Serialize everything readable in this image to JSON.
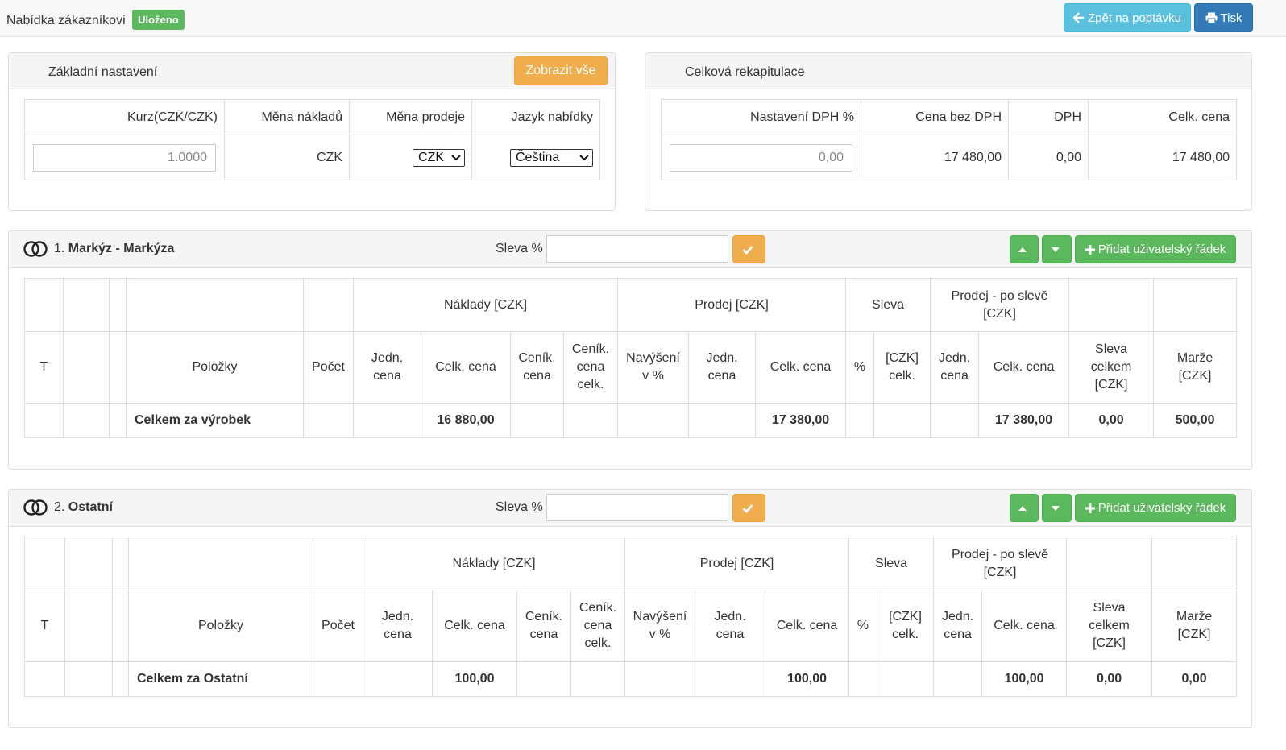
{
  "header": {
    "title": "Nabídka zákazníkovi",
    "status_badge": "Uloženo",
    "back_button": "Zpět na poptávku",
    "print_button": "Tisk"
  },
  "basic_settings": {
    "title": "Základní nastavení",
    "show_all_button": "Zobrazit vše",
    "columns": [
      "Kurz(CZK/CZK)",
      "Měna nákladů",
      "Měna prodeje",
      "Jazyk nabídky"
    ],
    "rate_value": "1.0000",
    "cost_currency": "CZK",
    "sale_currency": "CZK",
    "language": "Čeština"
  },
  "recap": {
    "title": "Celková rekapitulace",
    "columns": [
      "Nastavení DPH %",
      "Cena bez DPH",
      "DPH",
      "Celk. cena"
    ],
    "vat_value": "0,00",
    "price_without_vat": "17 480,00",
    "vat": "0,00",
    "total": "17 480,00"
  },
  "common": {
    "discount_label": "Sleva %",
    "add_row_button": "Přidat uživatelský řádek",
    "group_headers": {
      "costs": "Náklady [CZK]",
      "sales": "Prodej [CZK]",
      "discount": "Sleva",
      "sales_after": "Prodej - po slevě [CZK]"
    },
    "columns": {
      "t": "T",
      "items": "Položky",
      "count": "Počet",
      "unit_price": "Jedn. cena",
      "total_price": "Celk. cena",
      "list_price": "Ceník. cena",
      "list_price_total": "Ceník. cena celk.",
      "markup": "Navýšení v %",
      "percent": "%",
      "czk_total": "[CZK] celk.",
      "discount_total": "Sleva celkem [CZK]",
      "margin": "Marže [CZK]"
    }
  },
  "sections": [
    {
      "number": "1.",
      "name": "Markýz - Markýza",
      "total_label": "Celkem za výrobek",
      "cost_total": "16 880,00",
      "sale_total": "17 380,00",
      "sale_after_total": "17 380,00",
      "discount_total": "0,00",
      "margin": "500,00"
    },
    {
      "number": "2.",
      "name": "Ostatní",
      "total_label": "Celkem za Ostatní",
      "cost_total": "100,00",
      "sale_total": "100,00",
      "sale_after_total": "100,00",
      "discount_total": "0,00",
      "margin": "0,00"
    }
  ]
}
